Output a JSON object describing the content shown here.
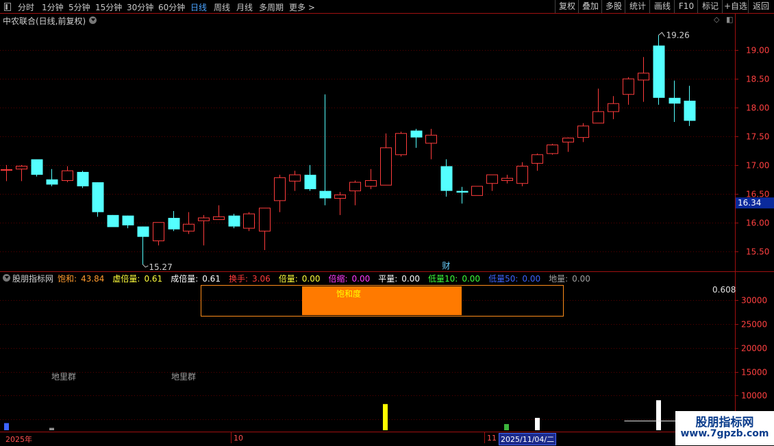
{
  "toolbar": {
    "periods": [
      "分时",
      "1分钟",
      "5分钟",
      "15分钟",
      "30分钟",
      "60分钟",
      "日线",
      "周线",
      "月线",
      "多周期",
      "更多 >"
    ],
    "active_period": "日线",
    "buttons": [
      "复权",
      "叠加",
      "多股",
      "统计",
      "画线",
      "F10",
      "标记",
      "+自选",
      "返回"
    ]
  },
  "main_title": "中农联合(日线,前复权)",
  "indicator": {
    "name": "股朋指标网",
    "items": [
      {
        "label": "饱和:",
        "value": "43.84",
        "color": "#ff9a2e"
      },
      {
        "label": "虚倍量:",
        "value": "0.61",
        "color": "#ffff3c"
      },
      {
        "label": "成倍量:",
        "value": "0.61",
        "color": "#ffffff"
      },
      {
        "label": "换手:",
        "value": "3.06",
        "color": "#ff3c3c"
      },
      {
        "label": "倍量:",
        "value": "0.00",
        "color": "#ffff3c"
      },
      {
        "label": "倍缩:",
        "value": "0.00",
        "color": "#ff3cff"
      },
      {
        "label": "平量:",
        "value": "0.00",
        "color": "#ffffff"
      },
      {
        "label": "低量10:",
        "value": "0.00",
        "color": "#3cff3c"
      },
      {
        "label": "低量50:",
        "value": "0.00",
        "color": "#3c64ff"
      },
      {
        "label": "地量:",
        "value": "0.00",
        "color": "#a0a0a0"
      }
    ],
    "box_label": "饱和度",
    "box_value": "0.608",
    "ground_labels": [
      "地里群",
      "地里群"
    ]
  },
  "colors": {
    "up": "#ff3c3c",
    "down": "#54ffff",
    "grid": "#5a0000",
    "axis": "#a01010"
  },
  "chart_data": [
    {
      "type": "candlestick",
      "title": "中农联合(日线,前复权)",
      "y_ticks": [
        15.5,
        16.0,
        16.5,
        17.0,
        17.5,
        18.0,
        18.5,
        19.0
      ],
      "ylim": [
        15.15,
        19.42
      ],
      "current_price": "16.34",
      "max_label": "19.26",
      "min_label": "15.27",
      "event_marker": "财",
      "candles": [
        {
          "o": 16.92,
          "h": 17.0,
          "l": 16.72,
          "c": 16.92
        },
        {
          "o": 16.93,
          "h": 17.0,
          "l": 16.72,
          "c": 16.98
        },
        {
          "o": 17.1,
          "h": 17.1,
          "l": 16.8,
          "c": 16.83
        },
        {
          "o": 16.75,
          "h": 16.93,
          "l": 16.63,
          "c": 16.66
        },
        {
          "o": 16.73,
          "h": 16.98,
          "l": 16.7,
          "c": 16.9
        },
        {
          "o": 16.88,
          "h": 16.9,
          "l": 16.6,
          "c": 16.63
        },
        {
          "o": 16.7,
          "h": 16.7,
          "l": 16.1,
          "c": 16.18
        },
        {
          "o": 16.13,
          "h": 16.13,
          "l": 15.98,
          "c": 15.92
        },
        {
          "o": 16.12,
          "h": 16.12,
          "l": 15.9,
          "c": 15.95
        },
        {
          "o": 15.93,
          "h": 15.93,
          "l": 15.27,
          "c": 15.75
        },
        {
          "o": 15.68,
          "h": 16.0,
          "l": 15.6,
          "c": 16.0
        },
        {
          "o": 16.08,
          "h": 16.2,
          "l": 15.85,
          "c": 15.88
        },
        {
          "o": 15.85,
          "h": 16.18,
          "l": 15.8,
          "c": 15.97
        },
        {
          "o": 16.03,
          "h": 16.13,
          "l": 15.6,
          "c": 16.08
        },
        {
          "o": 16.05,
          "h": 16.3,
          "l": 16.05,
          "c": 16.1
        },
        {
          "o": 16.12,
          "h": 16.15,
          "l": 15.9,
          "c": 15.93
        },
        {
          "o": 15.9,
          "h": 16.18,
          "l": 15.85,
          "c": 16.15
        },
        {
          "o": 15.85,
          "h": 16.25,
          "l": 15.52,
          "c": 16.25
        },
        {
          "o": 16.38,
          "h": 16.83,
          "l": 16.18,
          "c": 16.78
        },
        {
          "o": 16.72,
          "h": 16.9,
          "l": 16.55,
          "c": 16.83
        },
        {
          "o": 16.83,
          "h": 17.0,
          "l": 16.55,
          "c": 16.58
        },
        {
          "o": 16.55,
          "h": 18.23,
          "l": 16.3,
          "c": 16.42
        },
        {
          "o": 16.42,
          "h": 16.53,
          "l": 16.13,
          "c": 16.48
        },
        {
          "o": 16.55,
          "h": 16.73,
          "l": 16.3,
          "c": 16.7
        },
        {
          "o": 16.63,
          "h": 16.93,
          "l": 16.58,
          "c": 16.73
        },
        {
          "o": 16.65,
          "h": 17.55,
          "l": 16.65,
          "c": 17.3
        },
        {
          "o": 17.18,
          "h": 17.58,
          "l": 17.15,
          "c": 17.55
        },
        {
          "o": 17.6,
          "h": 17.63,
          "l": 17.3,
          "c": 17.48
        },
        {
          "o": 17.38,
          "h": 17.63,
          "l": 17.1,
          "c": 17.52
        },
        {
          "o": 16.98,
          "h": 17.1,
          "l": 16.45,
          "c": 16.55
        },
        {
          "o": 16.55,
          "h": 16.62,
          "l": 16.33,
          "c": 16.52
        },
        {
          "o": 16.47,
          "h": 16.63,
          "l": 16.47,
          "c": 16.63
        },
        {
          "o": 16.68,
          "h": 16.83,
          "l": 16.55,
          "c": 16.83
        },
        {
          "o": 16.73,
          "h": 16.83,
          "l": 16.68,
          "c": 16.77
        },
        {
          "o": 16.68,
          "h": 17.05,
          "l": 16.63,
          "c": 16.98
        },
        {
          "o": 17.03,
          "h": 17.2,
          "l": 16.9,
          "c": 17.18
        },
        {
          "o": 17.2,
          "h": 17.37,
          "l": 17.18,
          "c": 17.35
        },
        {
          "o": 17.4,
          "h": 17.48,
          "l": 17.23,
          "c": 17.47
        },
        {
          "o": 17.48,
          "h": 17.73,
          "l": 17.4,
          "c": 17.68
        },
        {
          "o": 17.73,
          "h": 18.33,
          "l": 17.73,
          "c": 17.93
        },
        {
          "o": 17.93,
          "h": 18.2,
          "l": 17.8,
          "c": 18.07
        },
        {
          "o": 18.23,
          "h": 18.53,
          "l": 18.05,
          "c": 18.5
        },
        {
          "o": 18.48,
          "h": 18.88,
          "l": 18.1,
          "c": 18.6
        },
        {
          "o": 19.08,
          "h": 19.26,
          "l": 18.05,
          "c": 18.17
        },
        {
          "o": 18.17,
          "h": 18.47,
          "l": 17.75,
          "c": 18.07
        },
        {
          "o": 18.12,
          "h": 18.38,
          "l": 17.68,
          "c": 17.77
        }
      ]
    },
    {
      "type": "bar",
      "y_ticks": [
        5000,
        10000,
        15000,
        20000,
        25000,
        30000
      ],
      "ylim": [
        2700,
        33500
      ],
      "bars": [
        {
          "index": 0,
          "value": 4200,
          "color": "#3c64ff"
        },
        {
          "index": 3,
          "value": 3200,
          "color": "#909090"
        },
        {
          "index": 25,
          "value": 8200,
          "color": "#ffff00"
        },
        {
          "index": 33,
          "value": 4000,
          "color": "#3cb43c"
        },
        {
          "index": 35,
          "value": 5300,
          "color": "#ffffff"
        },
        {
          "index": 43,
          "value": 9000,
          "color": "#ffffff"
        }
      ]
    }
  ],
  "x_axis": {
    "labels": [
      "2025年",
      "10",
      "11",
      "2025/11/04/二"
    ]
  },
  "watermark": {
    "title": "股朋指标网",
    "url": "www.7gpzb.com"
  }
}
